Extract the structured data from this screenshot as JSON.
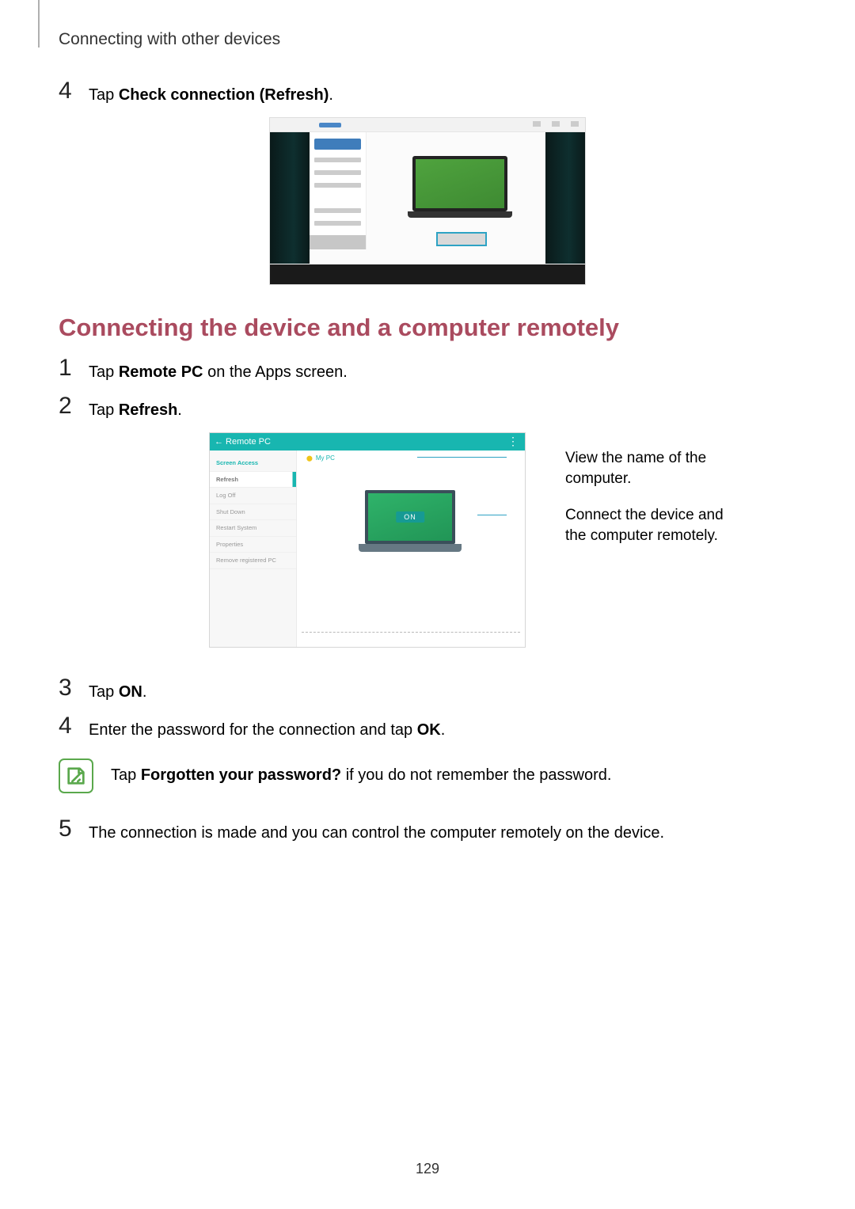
{
  "header": {
    "breadcrumb": "Connecting with other devices"
  },
  "top_step": {
    "num": "4",
    "pre": "Tap ",
    "bold": "Check connection (Refresh)",
    "post": "."
  },
  "heading": "Connecting the device and a computer remotely",
  "steps": [
    {
      "num": "1",
      "pre": "Tap ",
      "bold": "Remote PC",
      "post": " on the Apps screen."
    },
    {
      "num": "2",
      "pre": "Tap ",
      "bold": "Refresh",
      "post": "."
    },
    {
      "num": "3",
      "pre": "Tap ",
      "bold": "ON",
      "post": "."
    },
    {
      "num": "4",
      "pre": "Enter the password for the connection and tap ",
      "bold": "OK",
      "post": "."
    },
    {
      "num": "5",
      "pre": "The connection is made and you can control the computer remotely on the device.",
      "bold": "",
      "post": ""
    }
  ],
  "note": {
    "pre": "Tap ",
    "bold": "Forgotten your password?",
    "post": " if you do not remember the password."
  },
  "fig2": {
    "header_back": "←  Remote PC",
    "header_more": "⋮",
    "side_items": [
      "Screen Access",
      "Refresh",
      "Log Off",
      "Shut Down",
      "Restart System",
      "Properties",
      "Remove registered PC"
    ],
    "chip": "My PC",
    "on_label": "ON",
    "callouts": {
      "name": "View the name of the computer.",
      "connect": "Connect the device and the computer remotely."
    }
  },
  "page_number": "129"
}
